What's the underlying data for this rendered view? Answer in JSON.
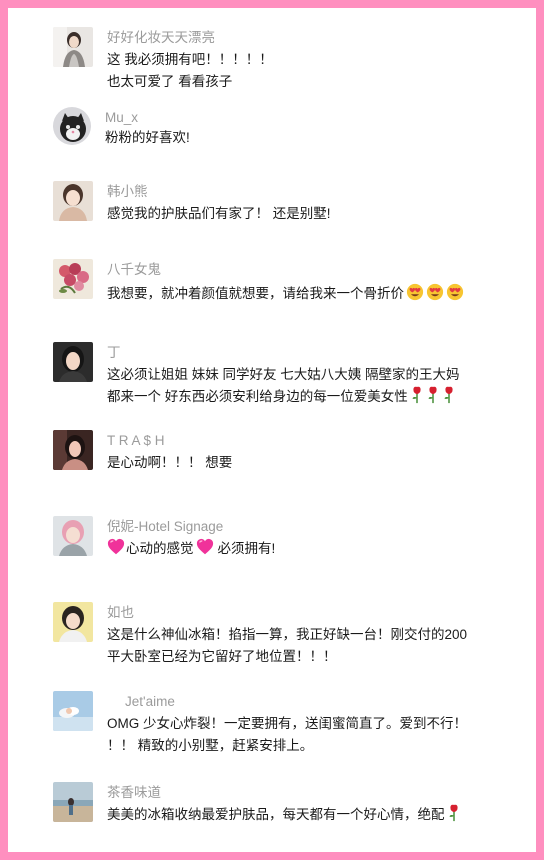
{
  "comments": [
    {
      "name": "好好化妆天天漂亮",
      "lines": [
        "这 我必须拥有吧！！！！！",
        "也太可爱了 看看孩子"
      ]
    },
    {
      "name": "Mu_x",
      "lines": [
        "粉粉的好喜欢!"
      ]
    },
    {
      "name": "韩小熊",
      "lines": [
        "感觉我的护肤品们有家了！ 还是别墅!"
      ]
    },
    {
      "name": "八千女鬼",
      "lines": [
        "我想要，就冲着颜值就想要，请给我来一个骨折价"
      ],
      "emoji": "heart-eyes-emoji x3"
    },
    {
      "name": "丁",
      "lines": [
        "这必须让姐姐 妹妹 同学好友 七大姑八大姨 隔壁家的王大妈",
        "都来一个 好东西必须安利给身边的每一位爱美女性"
      ],
      "emoji": "rose-emoji x3"
    },
    {
      "name": "T R A $ H",
      "lines": [
        "是心动啊！！！ 想要"
      ]
    },
    {
      "name": "倪妮-Hotel Signage",
      "lines": [
        "心动的感觉",
        "必须拥有!"
      ],
      "emoji": "pink-heart-emoji"
    },
    {
      "name": "如也",
      "lines": [
        "这是什么神仙冰箱！掐指一算，我正好缺一台！刚交付的200",
        "平大卧室已经为它留好了地位置！！！"
      ]
    },
    {
      "name": "Jet'aime",
      "lines": [
        "OMG 少女心炸裂！一定要拥有，送闺蜜简直了。爱到不行！",
        "！！ 精致的小别墅，赶紧安排上。"
      ]
    },
    {
      "name": "茶香味道",
      "lines": [
        "美美的冰箱收纳最爱护肤品，每天都有一个好心情，绝配"
      ],
      "emoji": "rose-emoji"
    }
  ],
  "colors": {
    "border": "#ff8fbf",
    "name": "#9b9b9b",
    "text": "#1a1a1a"
  }
}
